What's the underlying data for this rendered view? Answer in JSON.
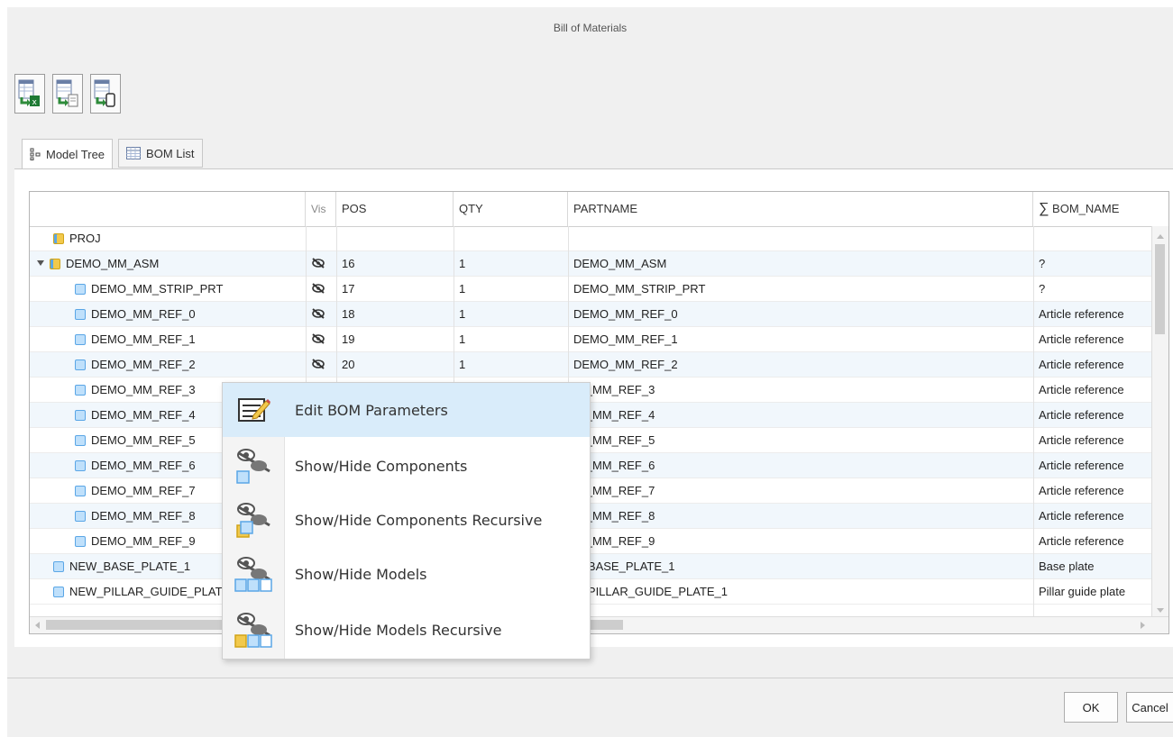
{
  "window": {
    "title": "Bill of Materials"
  },
  "toolbar": {
    "buttons": [
      {
        "icon": "export-excel-icon"
      },
      {
        "icon": "export-file-icon"
      },
      {
        "icon": "export-print-icon"
      }
    ]
  },
  "tabs": [
    {
      "label": "Model Tree",
      "icon": "tree-icon",
      "active": true
    },
    {
      "label": "BOM List",
      "icon": "table-icon",
      "active": false
    }
  ],
  "table": {
    "columns": [
      "",
      "Vis",
      "POS",
      "QTY",
      "PARTNAME",
      "BOM_NAME"
    ],
    "bom_name_prefix": "∑",
    "rows": [
      {
        "name": "PROJ",
        "type": "asm",
        "level": 0,
        "expander": false,
        "hidden": false,
        "pos": "",
        "qty": "",
        "partname": "",
        "bom_name": ""
      },
      {
        "name": "DEMO_MM_ASM",
        "type": "asm",
        "level": 0,
        "expander": true,
        "hidden": true,
        "pos": "16",
        "qty": "1",
        "partname": "DEMO_MM_ASM",
        "bom_name": "?"
      },
      {
        "name": "DEMO_MM_STRIP_PRT",
        "type": "part",
        "level": 1,
        "expander": false,
        "hidden": true,
        "pos": "17",
        "qty": "1",
        "partname": "DEMO_MM_STRIP_PRT",
        "bom_name": "?"
      },
      {
        "name": "DEMO_MM_REF_0",
        "type": "part",
        "level": 1,
        "expander": false,
        "hidden": true,
        "pos": "18",
        "qty": "1",
        "partname": "DEMO_MM_REF_0",
        "bom_name": "Article reference"
      },
      {
        "name": "DEMO_MM_REF_1",
        "type": "part",
        "level": 1,
        "expander": false,
        "hidden": true,
        "pos": "19",
        "qty": "1",
        "partname": "DEMO_MM_REF_1",
        "bom_name": "Article reference"
      },
      {
        "name": "DEMO_MM_REF_2",
        "type": "part",
        "level": 1,
        "expander": false,
        "hidden": true,
        "pos": "20",
        "qty": "1",
        "partname": "DEMO_MM_REF_2",
        "bom_name": "Article reference"
      },
      {
        "name": "DEMO_MM_REF_3",
        "type": "part",
        "level": 1,
        "expander": false,
        "hidden": false,
        "pos": "",
        "qty": "",
        "partname": "IO_MM_REF_3",
        "bom_name": "Article reference"
      },
      {
        "name": "DEMO_MM_REF_4",
        "type": "part",
        "level": 1,
        "expander": false,
        "hidden": false,
        "pos": "",
        "qty": "",
        "partname": "IO_MM_REF_4",
        "bom_name": "Article reference"
      },
      {
        "name": "DEMO_MM_REF_5",
        "type": "part",
        "level": 1,
        "expander": false,
        "hidden": false,
        "pos": "",
        "qty": "",
        "partname": "IO_MM_REF_5",
        "bom_name": "Article reference"
      },
      {
        "name": "DEMO_MM_REF_6",
        "type": "part",
        "level": 1,
        "expander": false,
        "hidden": false,
        "pos": "",
        "qty": "",
        "partname": "IO_MM_REF_6",
        "bom_name": "Article reference"
      },
      {
        "name": "DEMO_MM_REF_7",
        "type": "part",
        "level": 1,
        "expander": false,
        "hidden": false,
        "pos": "",
        "qty": "",
        "partname": "IO_MM_REF_7",
        "bom_name": "Article reference"
      },
      {
        "name": "DEMO_MM_REF_8",
        "type": "part",
        "level": 1,
        "expander": false,
        "hidden": false,
        "pos": "",
        "qty": "",
        "partname": "IO_MM_REF_8",
        "bom_name": "Article reference"
      },
      {
        "name": "DEMO_MM_REF_9",
        "type": "part",
        "level": 1,
        "expander": false,
        "hidden": false,
        "pos": "",
        "qty": "",
        "partname": "IO_MM_REF_9",
        "bom_name": "Article reference"
      },
      {
        "name": "NEW_BASE_PLATE_1",
        "type": "part",
        "level": 0,
        "expander": false,
        "hidden": false,
        "pos": "",
        "qty": "",
        "partname": "V_BASE_PLATE_1",
        "bom_name": "Base plate"
      },
      {
        "name": "NEW_PILLAR_GUIDE_PLATE_1",
        "type": "part",
        "level": 0,
        "expander": false,
        "hidden": false,
        "pos": "",
        "qty": "",
        "partname": "V_PILLAR_GUIDE_PLATE_1",
        "bom_name": "Pillar guide plate"
      }
    ]
  },
  "context_menu": {
    "items": [
      {
        "label": "Edit BOM Parameters",
        "icon": "edit-parameters-icon",
        "highlighted": true
      },
      {
        "label": "Show/Hide Components",
        "icon": "show-hide-component-icon",
        "highlighted": false
      },
      {
        "label": "Show/Hide Components Recursive",
        "icon": "show-hide-components-recursive-icon",
        "highlighted": false
      },
      {
        "label": "Show/Hide Models",
        "icon": "show-hide-models-icon",
        "highlighted": false
      },
      {
        "label": "Show/Hide Models Recursive",
        "icon": "show-hide-models-recursive-icon",
        "highlighted": false
      }
    ]
  },
  "footer": {
    "ok_label": "OK",
    "cancel_label": "Cancel"
  },
  "colors": {
    "row_alt": "#f1f7fc",
    "highlight": "#d9ecfa",
    "part_fill": "#bfe0fb",
    "asm_fill": "#f2c94c"
  }
}
